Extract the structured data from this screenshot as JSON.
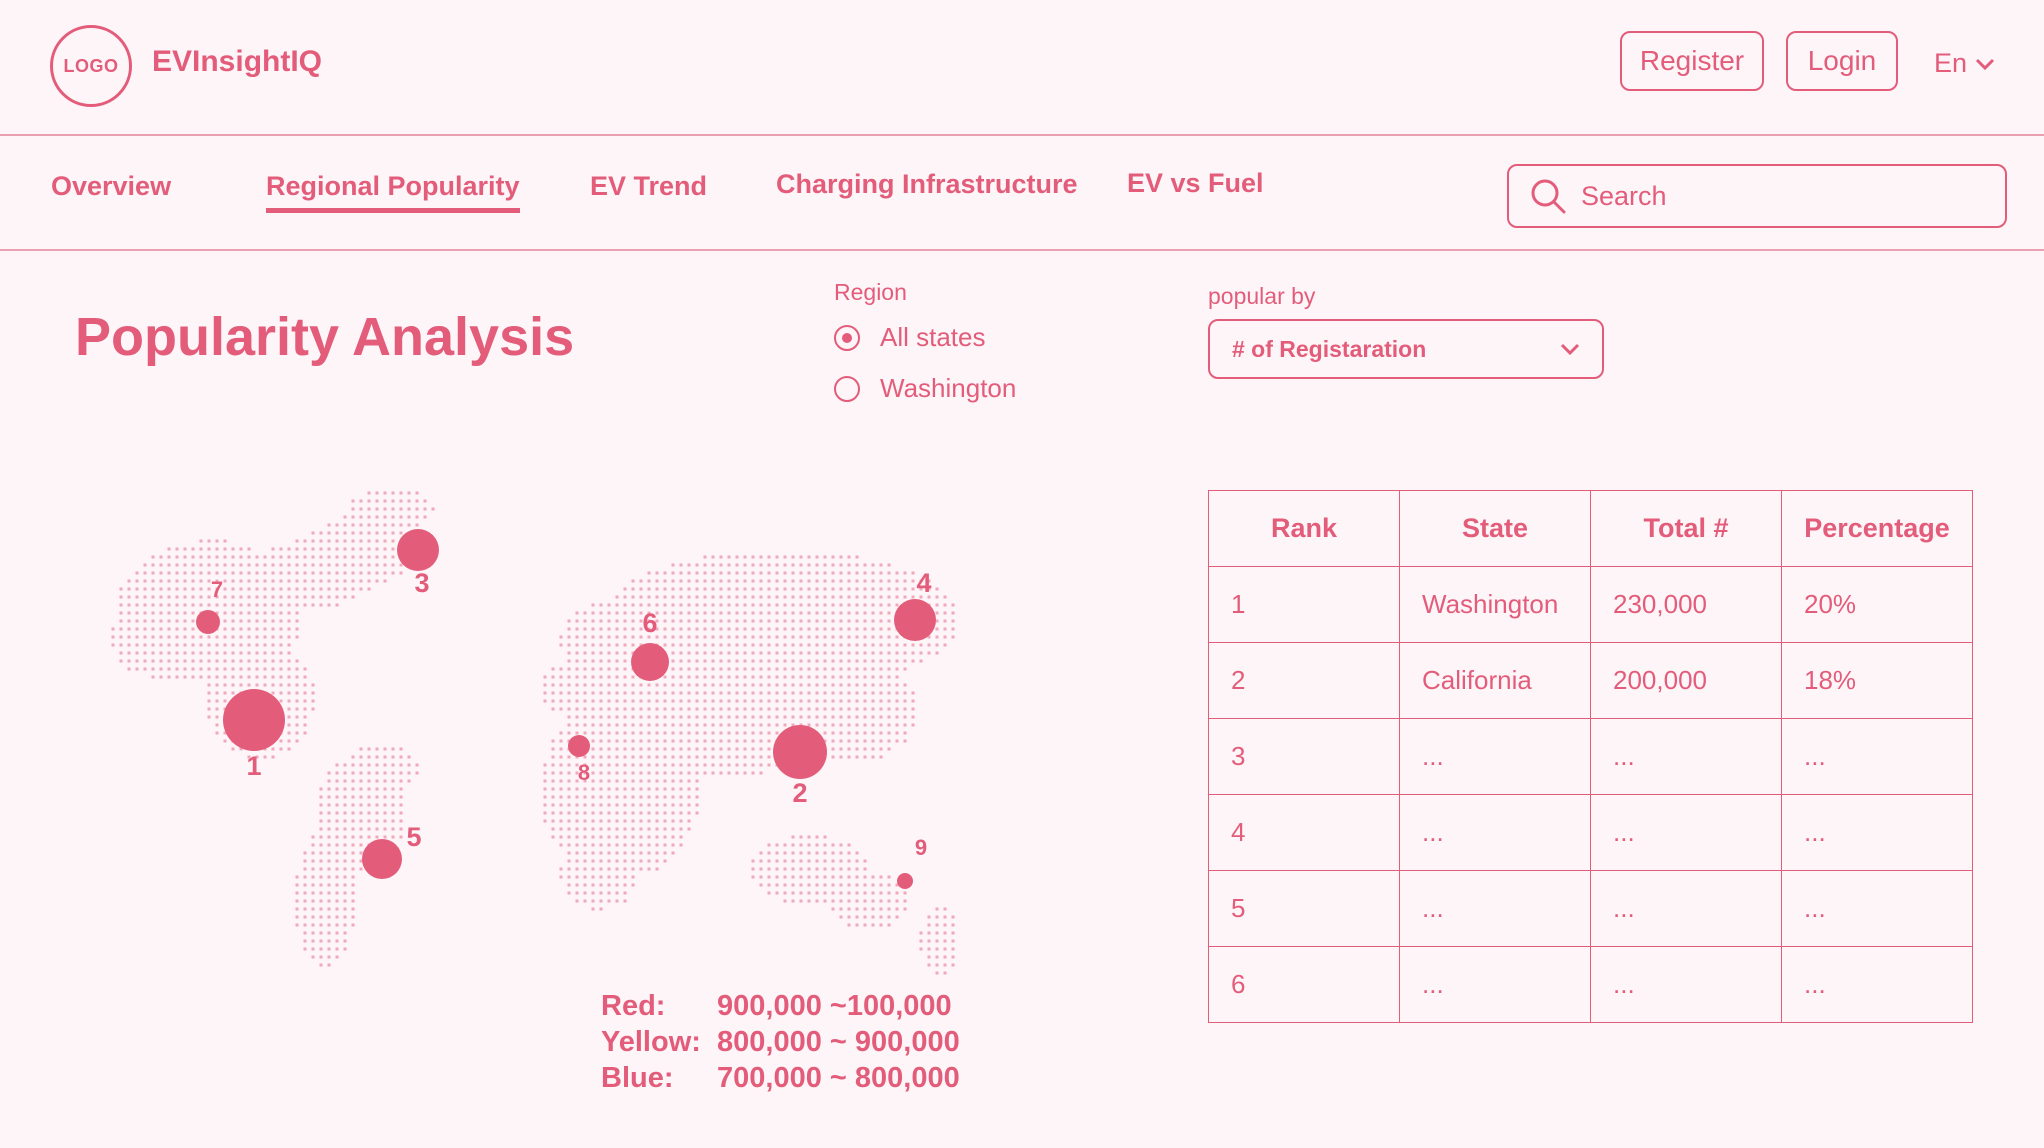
{
  "header": {
    "logo_text": "LOGO",
    "brand": "EVInsightIQ",
    "register_label": "Register",
    "login_label": "Login",
    "language": "En"
  },
  "nav": {
    "tabs": [
      {
        "label": "Overview"
      },
      {
        "label": "Regional Popularity",
        "active": true
      },
      {
        "label": "EV Trend"
      },
      {
        "label": "Charging Infrastructure"
      },
      {
        "label": "EV vs Fuel"
      }
    ],
    "search_placeholder": "Search"
  },
  "main": {
    "title": "Popularity Analysis",
    "region": {
      "label": "Region",
      "options": [
        {
          "label": "All states",
          "selected": true
        },
        {
          "label": "Washington",
          "selected": false
        }
      ]
    },
    "popular_by": {
      "label": "popular by",
      "selected": "# of Registaration"
    }
  },
  "map": {
    "markers": [
      "1",
      "2",
      "3",
      "4",
      "5",
      "6",
      "7",
      "8",
      "9"
    ]
  },
  "legend": [
    {
      "key": "Red:",
      "range": "900,000 ~100,000"
    },
    {
      "key": "Yellow:",
      "range": "800,000 ~ 900,000"
    },
    {
      "key": "Blue:",
      "range": "700,000 ~ 800,000"
    }
  ],
  "table": {
    "columns": [
      "Rank",
      "State",
      "Total #",
      "Percentage"
    ],
    "rows": [
      [
        "1",
        "Washington",
        "230,000",
        "20%"
      ],
      [
        "2",
        "California",
        "200,000",
        "18%"
      ],
      [
        "3",
        "...",
        "...",
        "..."
      ],
      [
        "4",
        "...",
        "...",
        "..."
      ],
      [
        "5",
        "...",
        "...",
        "..."
      ],
      [
        "6",
        "...",
        "...",
        "..."
      ]
    ]
  },
  "colors": {
    "accent": "#e35d7b",
    "background": "#fdf5f8",
    "map_dots": "#f0a9bb"
  }
}
